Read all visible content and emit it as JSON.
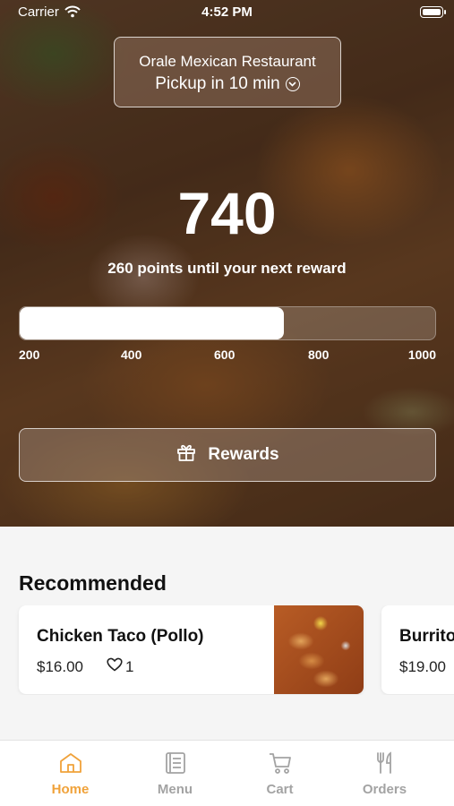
{
  "status_bar": {
    "carrier": "Carrier",
    "time": "4:52 PM"
  },
  "store": {
    "name": "Orale Mexican Restaurant",
    "pickup": "Pickup in 10 min"
  },
  "points": {
    "value": "740",
    "subtitle": "260 points until your next reward",
    "progress_fraction": 0.635,
    "scale_labels": [
      "200",
      "400",
      "600",
      "800",
      "1000"
    ]
  },
  "rewards_button": {
    "label": "Rewards"
  },
  "recommended": {
    "title": "Recommended",
    "items": [
      {
        "name": "Chicken Taco (Pollo)",
        "price": "$16.00",
        "likes": "1"
      },
      {
        "name": "Burrito",
        "price": "$19.00"
      }
    ]
  },
  "tabs": [
    {
      "label": "Home",
      "icon": "home-icon",
      "active": true
    },
    {
      "label": "Menu",
      "icon": "menu-book-icon",
      "active": false
    },
    {
      "label": "Cart",
      "icon": "cart-icon",
      "active": false
    },
    {
      "label": "Orders",
      "icon": "fork-knife-icon",
      "active": false
    }
  ],
  "colors": {
    "accent": "#f0a23a",
    "inactive_tab": "#a3a3a3"
  }
}
